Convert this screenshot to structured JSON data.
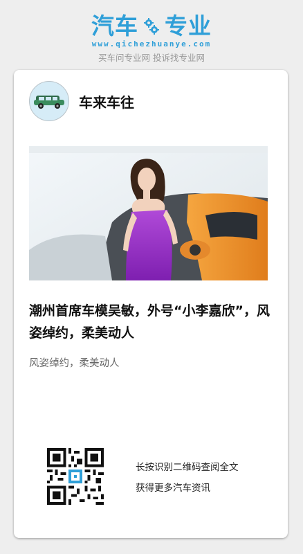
{
  "header": {
    "logo_left": "汽车",
    "logo_right": "专业",
    "logo_icon": "gear-icon",
    "domain": "www.qichezhuanye.com",
    "slogan": "买车问专业网 投诉找专业网",
    "brand_color": "#2f9fd8"
  },
  "card": {
    "account_name": "车来车往",
    "avatar_icon": "car-icon",
    "article_title": "潮州首席车模吴敏，外号“小李嘉欣”，风姿绰约，柔美动人",
    "summary": "风姿绰约，柔美动人",
    "qr_icon": "qr-code-icon",
    "qr_line1": "长按识别二维码查阅全文",
    "qr_line2": "获得更多汽车资讯"
  }
}
